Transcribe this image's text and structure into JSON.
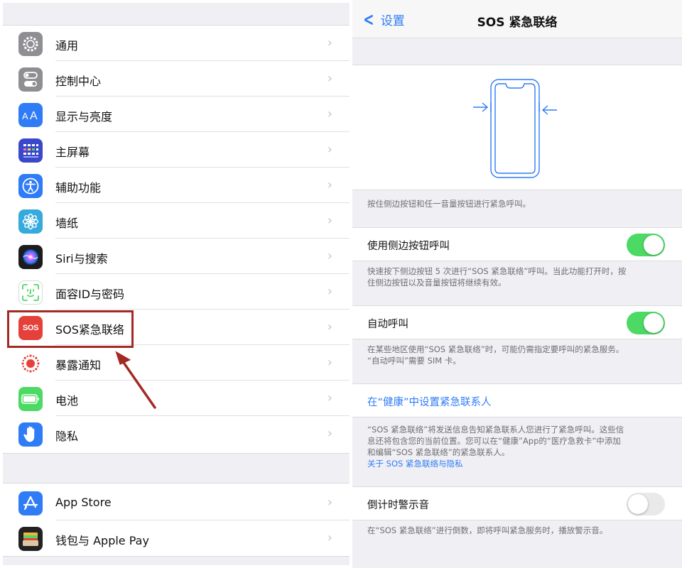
{
  "left": {
    "group1": [
      {
        "label": "通用",
        "icon": "gear-icon",
        "color": "#8e8e93"
      },
      {
        "label": "控制中心",
        "icon": "toggle-icon",
        "color": "#8e8e93"
      },
      {
        "label": "显示与亮度",
        "icon": "text-size-icon",
        "color": "#2f7cf6"
      },
      {
        "label": "主屏幕",
        "icon": "home-grid-icon",
        "color": "#3a49c9"
      },
      {
        "label": "辅助功能",
        "icon": "accessibility-icon",
        "color": "#2f7cf6"
      },
      {
        "label": "墙纸",
        "icon": "flower-icon",
        "color": "#35aadc"
      },
      {
        "label": "Siri与搜索",
        "icon": "siri-icon",
        "color": "#222222"
      },
      {
        "label": "面容ID与密码",
        "icon": "face-id-icon",
        "color": "#4cd964"
      },
      {
        "label": "SOS紧急联络",
        "icon": "sos-icon",
        "color": "#e5413a"
      },
      {
        "label": "暴露通知",
        "icon": "exposure-icon",
        "color": "#ffffff"
      },
      {
        "label": "电池",
        "icon": "battery-icon",
        "color": "#4cd964"
      },
      {
        "label": "隐私",
        "icon": "hand-icon",
        "color": "#2f7cf6"
      }
    ],
    "group2": [
      {
        "label": "App Store",
        "icon": "app-store-icon",
        "color": "#2f7cf6"
      },
      {
        "label": "钱包与 Apple Pay",
        "icon": "wallet-icon",
        "color": "#222222"
      }
    ],
    "sos_icon_text": "SOS"
  },
  "right": {
    "back_label": "设置",
    "title": "SOS 紧急联络",
    "note1": "按住侧边按钮和任一音量按钮进行紧急呼叫。",
    "toggle1": {
      "label": "使用侧边按钮呼叫",
      "on": true
    },
    "note2_line1": "快速按下侧边按钮 5 次进行“SOS 紧急联络”呼叫。当此功能打开时，按",
    "note2_line2": "住侧边按钮以及音量按钮将继续有效。",
    "toggle2": {
      "label": "自动呼叫",
      "on": true
    },
    "note3_line1": "在某些地区使用“SOS 紧急联络”时，可能仍需指定要呼叫的紧急服务。",
    "note3_line2": "“自动呼叫”需要 SIM 卡。",
    "health_link": "在“健康”中设置紧急联系人",
    "note4_line1": "“SOS 紧急联络”将发送信息告知紧急联系人您进行了紧急呼叫。这些信",
    "note4_line2": "息还将包含您的当前位置。您可以在“健康”App的“医疗急救卡”中添加",
    "note4_line3": "和编辑“SOS 紧急联络”的紧急联系人。",
    "privacy_link": "关于 SOS 紧急联络与隐私",
    "toggle3": {
      "label": "倒计时警示音",
      "on": false
    },
    "note5": "在“SOS 紧急联络”进行倒数，即将呼叫紧急服务时，播放警示音。"
  },
  "colors": {
    "accent": "#2f7cf6",
    "toggle_on": "#4cd964",
    "highlight": "#a32a24"
  }
}
